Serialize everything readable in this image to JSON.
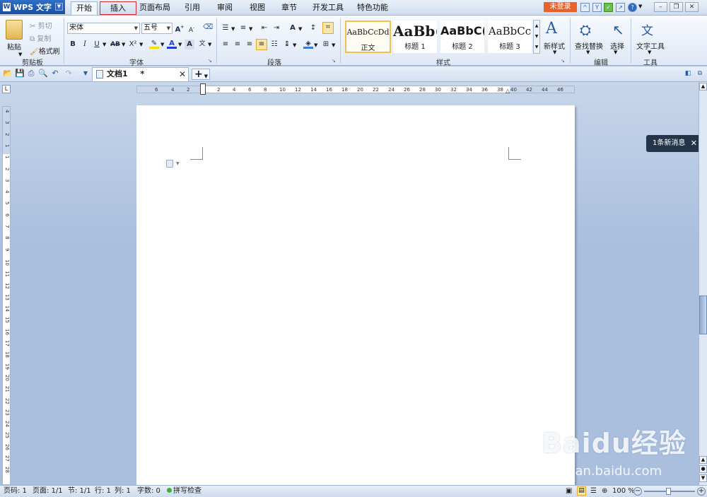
{
  "menubar": {
    "app_name": "WPS 文字",
    "tabs": [
      "开始",
      "插入",
      "页面布局",
      "引用",
      "审阅",
      "视图",
      "章节",
      "开发工具",
      "特色功能"
    ],
    "login_label": "未登录",
    "help_label": "?"
  },
  "ribbon": {
    "clipboard": {
      "paste": "粘贴",
      "cut": "剪切",
      "copy": "复制",
      "format_painter": "格式刷",
      "group_label": "剪贴板"
    },
    "font": {
      "font_name": "宋体",
      "font_size": "五号",
      "group_label": "字体",
      "bold": "B",
      "italic": "I",
      "underline": "U",
      "strike": "AB",
      "superscript": "X²"
    },
    "paragraph": {
      "group_label": "段落"
    },
    "styles": {
      "tiles": [
        {
          "preview": "AaBbCcDd",
          "label": "正文"
        },
        {
          "preview": "AaBb(",
          "label": "标题 1"
        },
        {
          "preview": "AaBbC(",
          "label": "标题 2"
        },
        {
          "preview": "AaBbCc",
          "label": "标题 3"
        }
      ],
      "group_label": "样式",
      "new_style": "新样式"
    },
    "editing": {
      "find_replace": "查找替换",
      "select": "选择",
      "group_label": "编辑"
    },
    "tools": {
      "text_tools": "文字工具",
      "group_label": "工具"
    }
  },
  "document_tab": {
    "title": "文档1",
    "modified_marker": "*"
  },
  "ruler": {
    "horizontal_ticks": [
      "6",
      "4",
      "2",
      "2",
      "4",
      "6",
      "8",
      "10",
      "12",
      "14",
      "16",
      "18",
      "20",
      "22",
      "24",
      "26",
      "28",
      "30",
      "32",
      "34",
      "36",
      "38",
      "40",
      "42",
      "44",
      "46"
    ],
    "vertical_ticks": [
      "4",
      "3",
      "2",
      "1",
      "1",
      "2",
      "3",
      "4",
      "5",
      "6",
      "7",
      "8",
      "9",
      "10",
      "11",
      "12",
      "13",
      "14",
      "15",
      "16",
      "17",
      "18",
      "19",
      "20",
      "21",
      "22",
      "23",
      "24",
      "25",
      "26",
      "27",
      "28"
    ]
  },
  "notification": {
    "text": "1条新消息"
  },
  "statusbar": {
    "page_code": "页码: 1",
    "pages": "页面: 1/1",
    "section": "节: 1/1",
    "row": "行: 1",
    "column": "列: 1",
    "word_count": "字数: 0",
    "spell_check": "拼写检查",
    "zoom": "100 %"
  },
  "watermark": {
    "logo": "Baidu经验",
    "url": "jingyan.baidu.com"
  },
  "colors": {
    "accent": "#1b4fa0",
    "login": "#e8632b",
    "notification": "#243549",
    "spell_ok": "#3bb13b"
  }
}
